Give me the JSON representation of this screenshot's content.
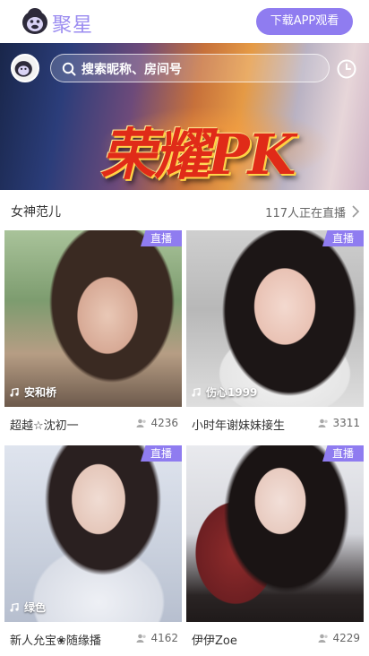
{
  "header": {
    "brand": "聚星",
    "download_label": "下载APP观看"
  },
  "banner": {
    "title": "荣耀PK"
  },
  "search": {
    "placeholder": "搜索昵称、房间号"
  },
  "section": {
    "title": "女神范儿",
    "live_count": "117人正在直播"
  },
  "cards": [
    {
      "badge": "直播",
      "anchor": "安和桥",
      "caption": "超越☆沈初一",
      "viewers": "4236"
    },
    {
      "badge": "直播",
      "anchor": "伤心1999",
      "caption": "小时年谢妹妹接生",
      "viewers": "3311"
    },
    {
      "badge": "直播",
      "anchor": "绿色",
      "caption": "新人允宝❀随缘播",
      "viewers": "4162"
    },
    {
      "badge": "直播",
      "anchor": "",
      "caption": "伊伊Zoe",
      "viewers": "4229"
    }
  ],
  "colors": {
    "accent": "#8f7cf0",
    "text": "#333333",
    "muted": "#666666"
  },
  "icons": [
    "gorilla-logo-icon",
    "search-icon",
    "history-clock-icon",
    "chevron-right-icon",
    "music-note-icon",
    "person-icon"
  ]
}
